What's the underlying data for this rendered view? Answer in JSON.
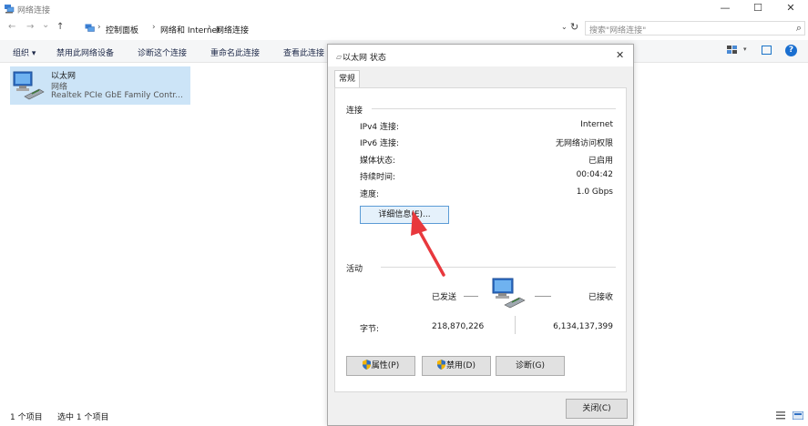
{
  "window": {
    "title": "网络连接",
    "minimize_glyph": "—",
    "maximize_glyph": "☐",
    "close_glyph": "✕"
  },
  "nav": {
    "back": "←",
    "forward": "→",
    "recent": "⌄",
    "up": "↑"
  },
  "address": {
    "crumbs": [
      "控制面板",
      "网络和 Internet",
      "网络连接"
    ],
    "separator": "›",
    "dropdown": "⌄",
    "refresh": "↻"
  },
  "search": {
    "placeholder": "搜索\"网络连接\"",
    "icon": "⌕"
  },
  "toolbar": {
    "organize": "组织 ▾",
    "disable_device": "禁用此网络设备",
    "diagnose": "诊断这个连接",
    "rename": "重命名此连接",
    "view_status": "查看此连接",
    "view_dropdown": "▾",
    "help": "?"
  },
  "adapter": {
    "name": "以太网",
    "network": "网络",
    "device": "Realtek PCIe GbE Family Contr..."
  },
  "statusbar": {
    "count": "1 个项目",
    "selected": "选中 1 个项目"
  },
  "dialog": {
    "title": "以太网 状态",
    "close_glyph": "✕",
    "tab": "常规",
    "connection": {
      "section": "连接",
      "rows": [
        {
          "label": "IPv4 连接:",
          "value": "Internet"
        },
        {
          "label": "IPv6 连接:",
          "value": "无网络访问权限"
        },
        {
          "label": "媒体状态:",
          "value": "已启用"
        },
        {
          "label": "持续时间:",
          "value": "00:04:42"
        },
        {
          "label": "速度:",
          "value": "1.0 Gbps"
        }
      ],
      "details_button": "详细信息(E)..."
    },
    "activity": {
      "section": "活动",
      "sent_label": "已发送",
      "received_label": "已接收",
      "bytes_label": "字节:",
      "sent_bytes": "218,870,226",
      "received_bytes": "6,134,137,399"
    },
    "buttons": {
      "properties": "属性(P)",
      "disable": "禁用(D)",
      "diagnose": "诊断(G)",
      "close": "关闭(C)"
    }
  },
  "colors": {
    "accent": "#1a73c8",
    "selection": "#cce4f7",
    "annotation_arrow": "#e8383d"
  }
}
